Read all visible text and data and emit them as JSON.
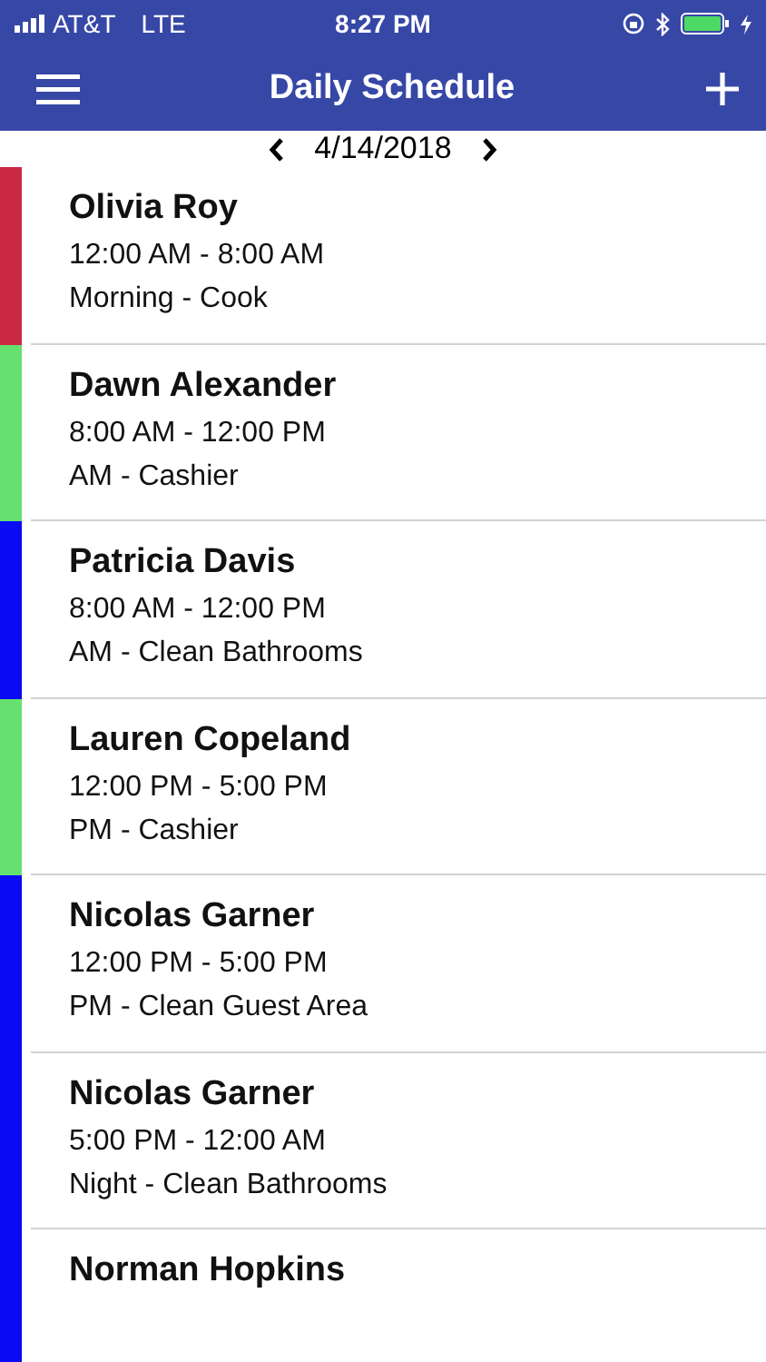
{
  "status_bar": {
    "carrier": "AT&T",
    "network": "LTE",
    "time": "8:27 PM"
  },
  "header": {
    "title": "Daily Schedule"
  },
  "date_nav": {
    "date": "4/14/2018"
  },
  "shifts": [
    {
      "name": "Olivia Roy",
      "time": "12:00 AM - 8:00 AM",
      "role": "Morning - Cook",
      "color": "#cc2a44"
    },
    {
      "name": "Dawn Alexander",
      "time": "8:00 AM - 12:00 PM",
      "role": "AM - Cashier",
      "color": "#66e070"
    },
    {
      "name": "Patricia Davis",
      "time": "8:00 AM - 12:00 PM",
      "role": "AM - Clean Bathrooms",
      "color": "#0a0af5"
    },
    {
      "name": "Lauren Copeland",
      "time": "12:00 PM - 5:00 PM",
      "role": "PM - Cashier",
      "color": "#66e070"
    },
    {
      "name": "Nicolas Garner",
      "time": "12:00 PM - 5:00 PM",
      "role": "PM - Clean Guest Area",
      "color": "#0a0af5"
    },
    {
      "name": "Nicolas Garner",
      "time": "5:00 PM - 12:00 AM",
      "role": "Night - Clean Bathrooms",
      "color": "#0a0af5"
    },
    {
      "name": "Norman Hopkins",
      "color": "#0a0af5"
    }
  ]
}
